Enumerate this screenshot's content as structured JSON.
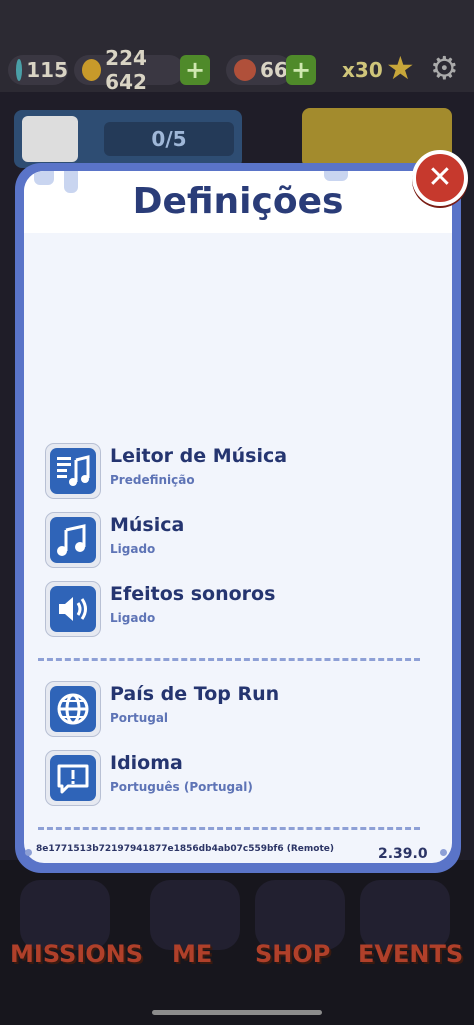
{
  "hud": {
    "keys": "115",
    "coins": "224 642",
    "boards": "66",
    "multiplier": "x30"
  },
  "banner": {
    "progress": "0/5"
  },
  "dialog": {
    "title": "Definições",
    "close_icon": "close-icon",
    "items": [
      {
        "label": "Leitor de Música",
        "value": "Predefinição",
        "icon": "music-player-icon"
      },
      {
        "label": "Música",
        "value": "Ligado",
        "icon": "music-note-icon"
      },
      {
        "label": "Efeitos sonoros",
        "value": "Ligado",
        "icon": "speaker-icon"
      },
      {
        "label": "País de Top Run",
        "value": "Portugal",
        "icon": "globe-icon"
      },
      {
        "label": "Idioma",
        "value": "Português (Portugal)",
        "icon": "language-icon"
      }
    ],
    "build_id": "8e1771513b72197941877e1856db4ab07c559bf6 (Remote)",
    "version": "2.39.0"
  },
  "nav": {
    "missions": "MISSIONS",
    "me": "ME",
    "shop": "SHOP",
    "events": "EVENTS"
  },
  "colors": {
    "dialog_border": "#5a74c8",
    "title": "#2a3c78",
    "icon_blue": "#2f64b8",
    "close_red": "#c6392d"
  }
}
